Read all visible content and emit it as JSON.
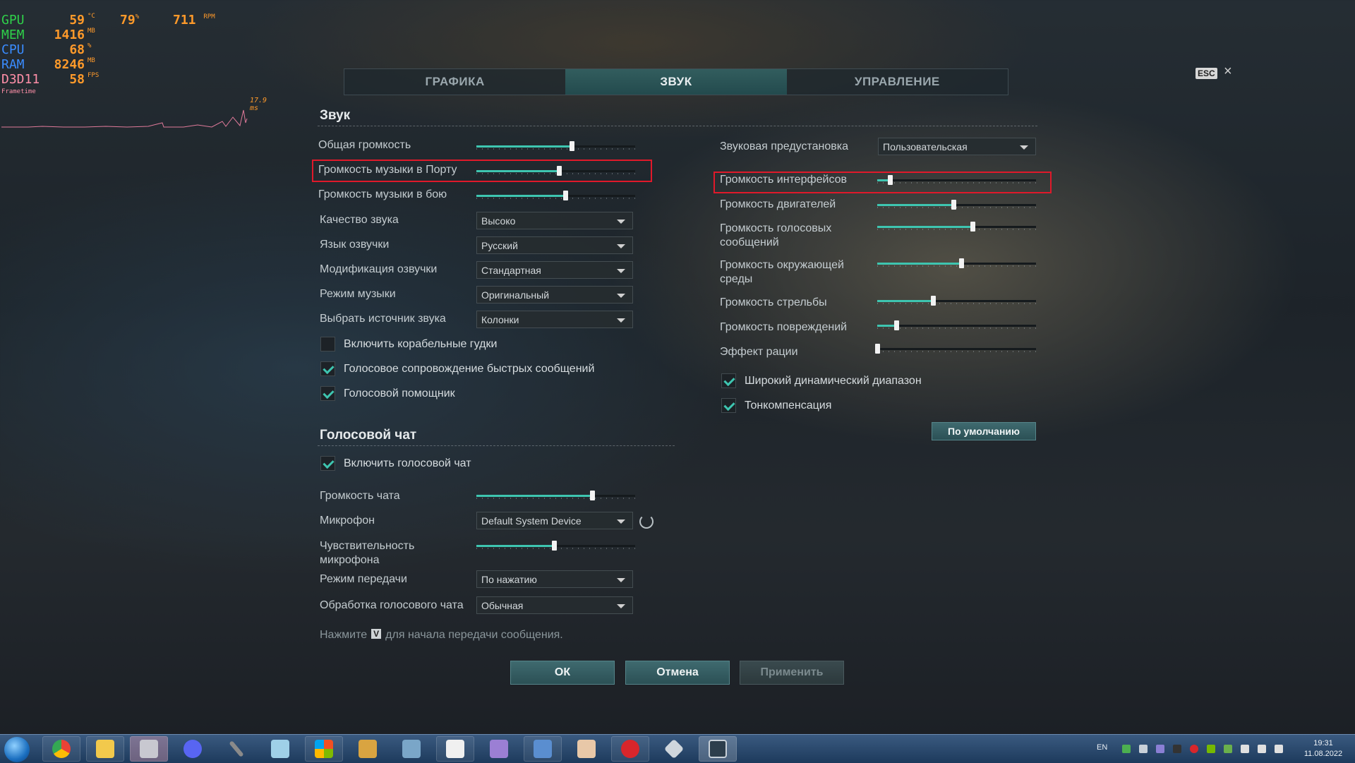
{
  "hud": {
    "rows": [
      {
        "label": "GPU",
        "value": "59",
        "unit": "°C",
        "color": "#2fd04a"
      },
      {
        "label": "MEM",
        "value": "1416",
        "unit": "MB",
        "color": "#2fd04a"
      },
      {
        "label": "CPU",
        "value": "68",
        "unit": "%",
        "color": "#3a8cff"
      },
      {
        "label": "RAM",
        "value": "8246",
        "unit": "MB",
        "color": "#3a8cff"
      },
      {
        "label": "D3D11",
        "value": "58",
        "unit": "FPS",
        "color": "#ff8fa8"
      }
    ],
    "gpu_load": "79",
    "gpu_load_unit": "%",
    "fan": "711",
    "fan_unit": "RPM",
    "frametime_label": "Frametime",
    "frametime_value": "17.9 ms"
  },
  "tabs": [
    {
      "label": "ГРАФИКА",
      "active": false
    },
    {
      "label": "ЗВУК",
      "active": true
    },
    {
      "label": "УПРАВЛЕНИЕ",
      "active": false
    }
  ],
  "esc_label": "ESC",
  "close_glyph": "×",
  "sound": {
    "title": "Звук",
    "sliders": [
      {
        "label": "Общая громкость",
        "value": 0.6
      },
      {
        "label": "Громкость музыки в Порту",
        "value": 0.52
      },
      {
        "label": "Громкость музыки в бою",
        "value": 0.56
      }
    ],
    "dropdowns": [
      {
        "label": "Качество звука",
        "value": "Высоко"
      },
      {
        "label": "Язык озвучки",
        "value": "Русский"
      },
      {
        "label": "Модификация озвучки",
        "value": "Стандартная"
      },
      {
        "label": "Режим музыки",
        "value": "Оригинальный"
      },
      {
        "label": "Выбрать источник звука",
        "value": "Колонки"
      }
    ],
    "checkboxes": [
      {
        "label": "Включить корабельные гудки",
        "checked": false
      },
      {
        "label": "Голосовое сопровождение быстрых сообщений",
        "checked": true
      },
      {
        "label": "Голосовой помощник",
        "checked": true
      }
    ]
  },
  "right": {
    "preset_label": "Звуковая предустановка",
    "preset_value": "Пользовательская",
    "sliders": [
      {
        "label": "Громкость интерфейсов",
        "value": 0.08
      },
      {
        "label": "Громкость двигателей",
        "value": 0.48
      },
      {
        "label": "Громкость голосовых сообщений",
        "value": 0.6
      },
      {
        "label": "Громкость окружающей среды",
        "value": 0.53
      },
      {
        "label": "Громкость стрельбы",
        "value": 0.35
      },
      {
        "label": "Громкость повреждений",
        "value": 0.12
      },
      {
        "label": "Эффект рации",
        "value": 0.0
      }
    ],
    "checkboxes": [
      {
        "label": "Широкий динамический диапазон",
        "checked": true
      },
      {
        "label": "Тонкомпенсация",
        "checked": true
      }
    ],
    "default_button": "По умолчанию"
  },
  "voice": {
    "title": "Голосовой чат",
    "enable_label": "Включить голосовой чат",
    "enable_checked": true,
    "chat_volume_label": "Громкость чата",
    "chat_volume": 0.73,
    "mic_label": "Микрофон",
    "mic_value": "Default System Device",
    "sens_label": "Чувствительность микрофона",
    "sens_value": 0.49,
    "mode_label": "Режим передачи",
    "mode_value": "По нажатию",
    "proc_label": "Обработка голосового чата",
    "proc_value": "Обычная",
    "hint_before": "Нажмите",
    "hint_key": "V",
    "hint_after": "для начала передачи сообщения."
  },
  "buttons": {
    "ok": "ОК",
    "cancel": "Отмена",
    "apply": "Применить"
  },
  "taskbar": {
    "lang": "EN",
    "time": "19:31",
    "date": "11.08.2022"
  }
}
